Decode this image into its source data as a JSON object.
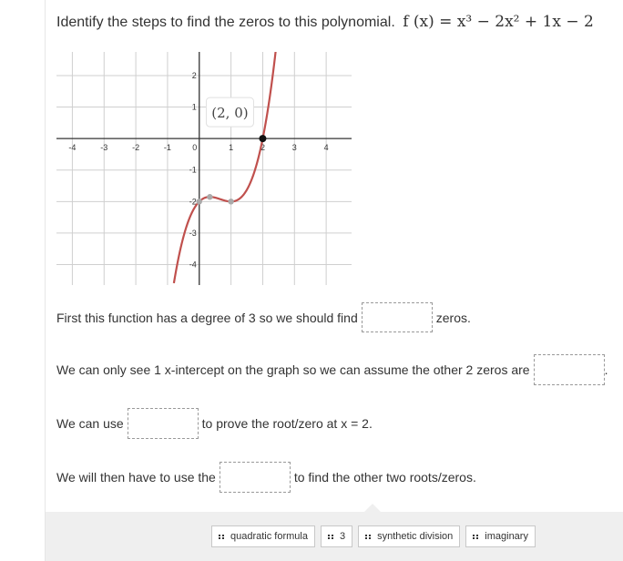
{
  "question": {
    "prompt": "Identify the steps to find the zeros to this polynomial.",
    "function_label": "f (x) = x³ − 2x² + 1x − 2"
  },
  "graph": {
    "x_ticks": [
      "-4",
      "-3",
      "-2",
      "-1",
      "0",
      "1",
      "2",
      "3",
      "4"
    ],
    "y_ticks": [
      "2",
      "1",
      "-1",
      "-2",
      "-3",
      "-4"
    ],
    "point_label": "(2, 0)",
    "curve_color": "#c0504d",
    "point_color": "#111111",
    "extrema_color": "#aaaaaa",
    "x_range": [
      -4.5,
      4.8
    ],
    "y_range": [
      -4.65,
      2.75
    ],
    "highlight_point": [
      2,
      0
    ],
    "marked_points": [
      [
        0,
        -2
      ],
      [
        0.333,
        -1.852
      ],
      [
        1,
        -2
      ]
    ]
  },
  "statements": [
    {
      "before": "First this function has a degree of 3 so we should find",
      "after": "zeros."
    },
    {
      "before": "We can only see 1 x-intercept on the graph so we can assume the other 2 zeros are",
      "after": "."
    },
    {
      "before": "We can use",
      "after": "to prove the root/zero at x = 2."
    },
    {
      "before": "We will then have to use the",
      "after": "to find the other two roots/zeros."
    }
  ],
  "answer_choices": [
    {
      "label": "quadratic formula",
      "icon": "drag-handle-icon"
    },
    {
      "label": "3",
      "icon": "drag-handle-icon"
    },
    {
      "label": "synthetic division",
      "icon": "drag-handle-icon"
    },
    {
      "label": "imaginary",
      "icon": "drag-handle-icon"
    }
  ]
}
